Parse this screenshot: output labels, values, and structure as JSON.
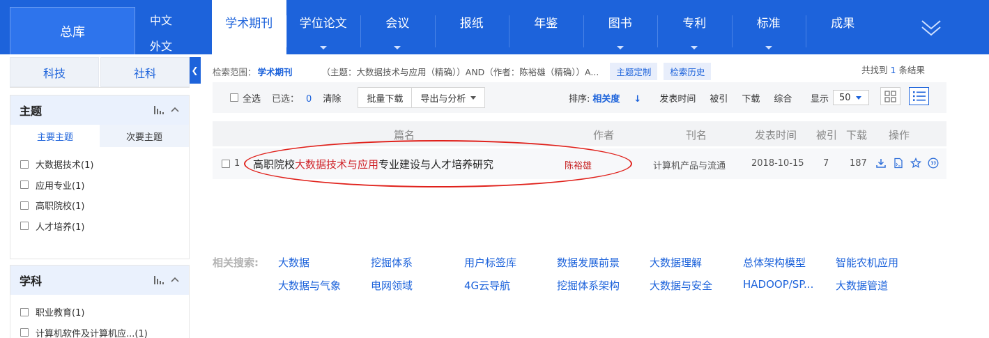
{
  "nav": {
    "zongku": "总库",
    "zh": "中文",
    "wai": "外文",
    "tabs": [
      {
        "label": "学术期刊",
        "caret": false
      },
      {
        "label": "学位论文",
        "caret": true
      },
      {
        "label": "会议",
        "caret": true
      },
      {
        "label": "报纸",
        "caret": false
      },
      {
        "label": "年鉴",
        "caret": false
      },
      {
        "label": "图书",
        "caret": true
      },
      {
        "label": "专利",
        "caret": true
      },
      {
        "label": "标准",
        "caret": true
      },
      {
        "label": "成果",
        "caret": false
      }
    ]
  },
  "sidebar": {
    "sci": "科技",
    "soc": "社科",
    "topic": {
      "title": "主题",
      "sub_main": "主要主题",
      "sub_minor": "次要主题",
      "items": [
        "大数据技术(1)",
        "应用专业(1)",
        "高职院校(1)",
        "人才培养(1)"
      ]
    },
    "subject": {
      "title": "学科",
      "items": [
        "职业教育(1)",
        "计算机软件及计算机应...(1)"
      ]
    }
  },
  "search": {
    "scope_label": "检索范围：",
    "scope_value": "学术期刊",
    "expr": "（主题：大数据技术与应用（精确））AND（作者：陈裕雄（精确））A...",
    "pill_custom": "主题定制",
    "pill_history": "检索历史",
    "found_prefix": "共找到",
    "found_count": "1",
    "found_suffix": "条结果"
  },
  "toolbar": {
    "select_all": "全选",
    "selected_label": "已选：",
    "selected_count": "0",
    "clear": "清除",
    "batch_download": "批量下载",
    "export": "导出与分析",
    "sort_label": "排序:",
    "sort_relevance": "相关度",
    "sort_date": "发表时间",
    "sort_cited": "被引",
    "sort_download": "下载",
    "sort_comprehensive": "综合",
    "display_label": "显示",
    "display_count": "50"
  },
  "table": {
    "headers": {
      "title": "篇名",
      "author": "作者",
      "journal": "刊名",
      "date": "发表时间",
      "cited": "被引",
      "download": "下载",
      "ops": "操作"
    },
    "rows": [
      {
        "num": "1",
        "title_pre": "高职院校",
        "title_hl": "大数据技术与应用",
        "title_post": "专业建设与人才培养研究",
        "author": "陈裕雄",
        "journal": "计算机产品与流通",
        "date": "2018-10-15",
        "cited": "7",
        "download": "187"
      }
    ]
  },
  "related": {
    "label": "相关搜索:",
    "items": [
      "大数据",
      "挖掘体系",
      "用户标签库",
      "数据发展前景",
      "大数据理解",
      "总体架构模型",
      "智能农机应用",
      "大数据与气象",
      "电网领域",
      "4G云导航",
      "挖掘体系架构",
      "大数据与安全",
      "HADOOP/SP...",
      "大数据管道"
    ]
  },
  "colors": {
    "brand": "#1d63db",
    "highlight": "#d0242a",
    "annotation": "#e0211b"
  }
}
